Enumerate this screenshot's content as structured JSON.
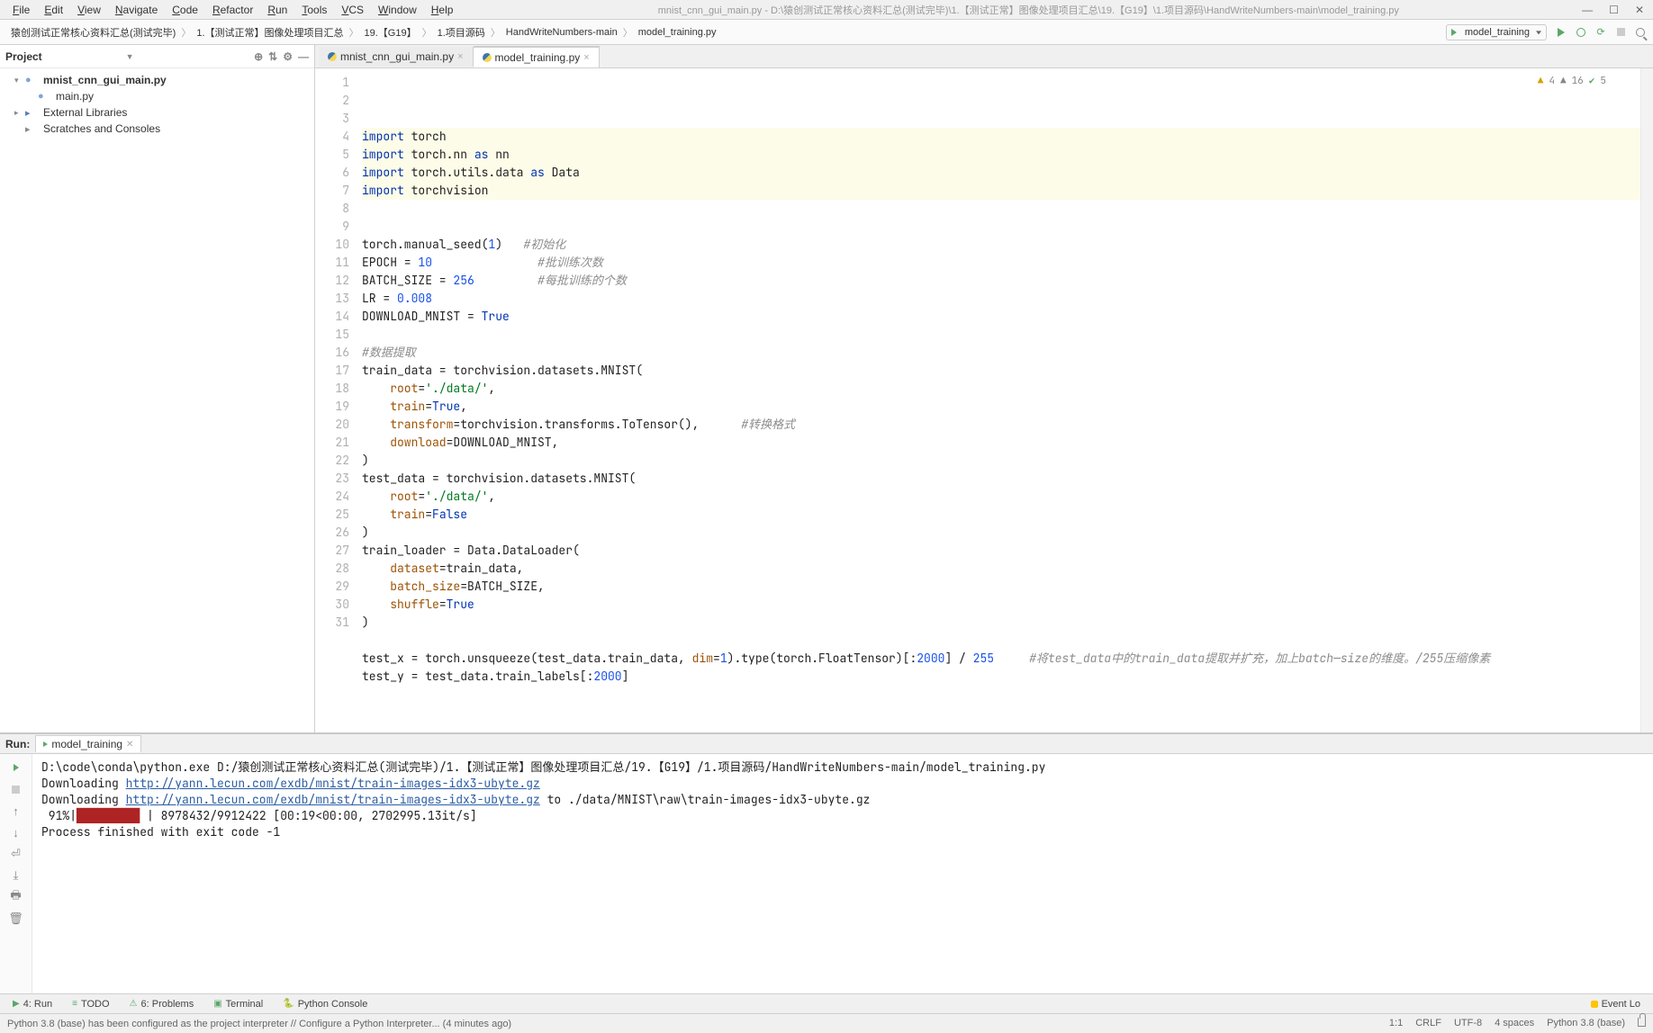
{
  "menu": [
    "File",
    "Edit",
    "View",
    "Navigate",
    "Code",
    "Refactor",
    "Run",
    "Tools",
    "VCS",
    "Window",
    "Help"
  ],
  "title_path": "mnist_cnn_gui_main.py - D:\\猿创测试正常核心资料汇总(测试完毕)\\1.【测试正常】图像处理项目汇总\\19.【G19】\\1.项目源码\\HandWriteNumbers-main\\model_training.py",
  "breadcrumbs": [
    "猿创测试正常核心资料汇总(测试完毕)",
    "1.【测试正常】图像处理项目汇总",
    "19.【G19】",
    "1.项目源码",
    "HandWriteNumbers-main",
    "model_training.py"
  ],
  "run_config": "model_training",
  "project": {
    "title": "Project",
    "tree": [
      {
        "label": "mnist_cnn_gui_main.py",
        "indent": 1,
        "bold": true,
        "chev": "▾",
        "icon": "py"
      },
      {
        "label": "main.py",
        "indent": 2,
        "bold": false,
        "chev": "",
        "icon": "py"
      },
      {
        "label": "External Libraries",
        "indent": 1,
        "bold": false,
        "chev": "▸",
        "icon": "lib"
      },
      {
        "label": "Scratches and Consoles",
        "indent": 1,
        "bold": false,
        "chev": "",
        "icon": "scratch"
      }
    ]
  },
  "tabs": [
    {
      "name": "mnist_cnn_gui_main.py",
      "active": false
    },
    {
      "name": "model_training.py",
      "active": true
    }
  ],
  "code_lines": [
    {
      "n": 1,
      "hl": true,
      "html": "<span class='kw'>import</span> torch"
    },
    {
      "n": 2,
      "hl": true,
      "html": "<span class='kw'>import</span> torch.nn <span class='kw'>as</span> nn"
    },
    {
      "n": 3,
      "hl": true,
      "html": "<span class='kw'>import</span> torch.utils.data <span class='kw'>as</span> Data"
    },
    {
      "n": 4,
      "hl": true,
      "html": "<span class='kw'>import</span> torchvision"
    },
    {
      "n": 5,
      "hl": false,
      "html": ""
    },
    {
      "n": 6,
      "hl": false,
      "html": ""
    },
    {
      "n": 7,
      "hl": false,
      "html": "torch.manual_seed(<span class='num'>1</span>)   <span class='cmt'>#初始化</span>"
    },
    {
      "n": 8,
      "hl": false,
      "html": "EPOCH = <span class='num'>10</span>               <span class='cmt'>#批训练次数</span>"
    },
    {
      "n": 9,
      "hl": false,
      "html": "BATCH_SIZE = <span class='num'>256</span>         <span class='cmt'>#每批训练的个数</span>"
    },
    {
      "n": 10,
      "hl": false,
      "html": "LR = <span class='num'>0.008</span>"
    },
    {
      "n": 11,
      "hl": false,
      "html": "DOWNLOAD_MNIST = <span class='bool'>True</span>"
    },
    {
      "n": 12,
      "hl": false,
      "html": ""
    },
    {
      "n": 13,
      "hl": false,
      "html": "<span class='cmt'>#数据提取</span>"
    },
    {
      "n": 14,
      "hl": false,
      "html": "train_data = torchvision.datasets.MNIST("
    },
    {
      "n": 15,
      "hl": false,
      "html": "    <span class='param'>root</span>=<span class='str'>'./data/'</span>,"
    },
    {
      "n": 16,
      "hl": false,
      "html": "    <span class='param'>train</span>=<span class='bool'>True</span>,"
    },
    {
      "n": 17,
      "hl": false,
      "html": "    <span class='param'>transform</span>=torchvision.transforms.ToTensor(),      <span class='cmt'>#转换格式</span>"
    },
    {
      "n": 18,
      "hl": false,
      "html": "    <span class='param'>download</span>=DOWNLOAD_MNIST,"
    },
    {
      "n": 19,
      "hl": false,
      "html": ")"
    },
    {
      "n": 20,
      "hl": false,
      "html": "test_data = torchvision.datasets.MNIST("
    },
    {
      "n": 21,
      "hl": false,
      "html": "    <span class='param'>root</span>=<span class='str'>'./data/'</span>,"
    },
    {
      "n": 22,
      "hl": false,
      "html": "    <span class='param'>train</span>=<span class='bool'>False</span>"
    },
    {
      "n": 23,
      "hl": false,
      "html": ")"
    },
    {
      "n": 24,
      "hl": false,
      "html": "train_loader = Data.DataLoader("
    },
    {
      "n": 25,
      "hl": false,
      "html": "    <span class='param'>dataset</span>=train_data,"
    },
    {
      "n": 26,
      "hl": false,
      "html": "    <span class='param'>batch_size</span>=BATCH_SIZE,"
    },
    {
      "n": 27,
      "hl": false,
      "html": "    <span class='param'>shuffle</span>=<span class='bool'>True</span>"
    },
    {
      "n": 28,
      "hl": false,
      "html": ")"
    },
    {
      "n": 29,
      "hl": false,
      "html": ""
    },
    {
      "n": 30,
      "hl": false,
      "html": "test_x = torch.unsqueeze(test_data.train_data, <span class='param'>dim</span>=<span class='num'>1</span>).type(torch.FloatTensor)[:<span class='num'>2000</span>] / <span class='num'>255</span>     <span class='cmt'>#将test_data中的train_data提取并扩充，加上batch—size的维度。/255压缩像素</span>"
    },
    {
      "n": 31,
      "hl": false,
      "html": "test_y = test_data.train_labels[:<span class='num'>2000</span>]"
    }
  ],
  "inspection": {
    "warn": "4",
    "sugg": "16",
    "check": "5"
  },
  "run": {
    "title": "Run:",
    "conf": "model_training",
    "output_lines": [
      {
        "html": "D:\\code\\conda\\python.exe D:/猿创测试正常核心资料汇总(测试完毕)/1.【测试正常】图像处理项目汇总/19.【G19】/1.项目源码/HandWriteNumbers-main/model_training.py"
      },
      {
        "html": "Downloading <a href='#'>http://yann.lecun.com/exdb/mnist/train-images-idx3-ubyte.gz</a>"
      },
      {
        "html": "Downloading <a href='#'>http://yann.lecun.com/exdb/mnist/train-images-idx3-ubyte.gz</a> to ./data/MNIST\\raw\\train-images-idx3-ubyte.gz"
      },
      {
        "html": " 91%|<span class='progbar'>█████████</span> | 8978432/9912422 [00:19<00:00, 2702995.13it/s]"
      },
      {
        "html": "Process finished with exit code -1"
      }
    ]
  },
  "tool_tabs": [
    {
      "icon": "▶",
      "label": "4: Run",
      "active": true
    },
    {
      "icon": "≡",
      "label": "TODO",
      "active": false
    },
    {
      "icon": "⚠",
      "label": "6: Problems",
      "active": false
    },
    {
      "icon": "▣",
      "label": "Terminal",
      "active": false
    },
    {
      "icon": "🐍",
      "label": "Python Console",
      "active": false
    }
  ],
  "event_log_label": "Event Lo",
  "status": {
    "msg": "Python 3.8 (base) has been configured as the project interpreter // Configure a Python Interpreter... (4 minutes ago)",
    "pos": "1:1",
    "eol": "CRLF",
    "enc": "UTF-8",
    "indent": "4 spaces",
    "py": "Python 3.8 (base)"
  }
}
